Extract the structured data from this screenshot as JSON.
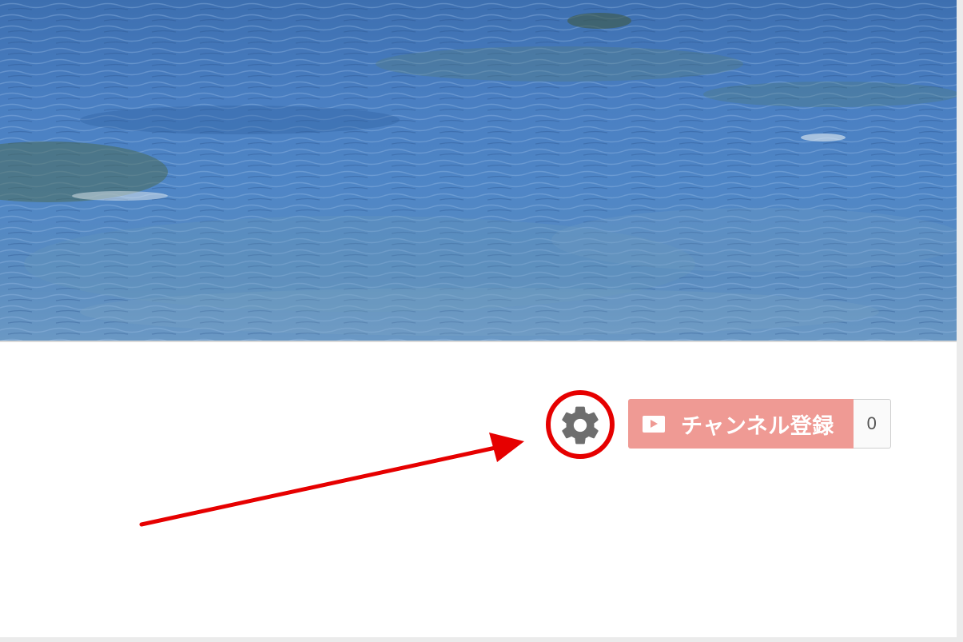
{
  "subscribe": {
    "label": "チャンネル登録",
    "count": "0",
    "icon": "youtube-play-icon",
    "color": "#ef9a94"
  },
  "settings": {
    "icon": "gear-icon",
    "color": "#6e6e6e"
  },
  "annotation": {
    "color": "#e60000"
  }
}
